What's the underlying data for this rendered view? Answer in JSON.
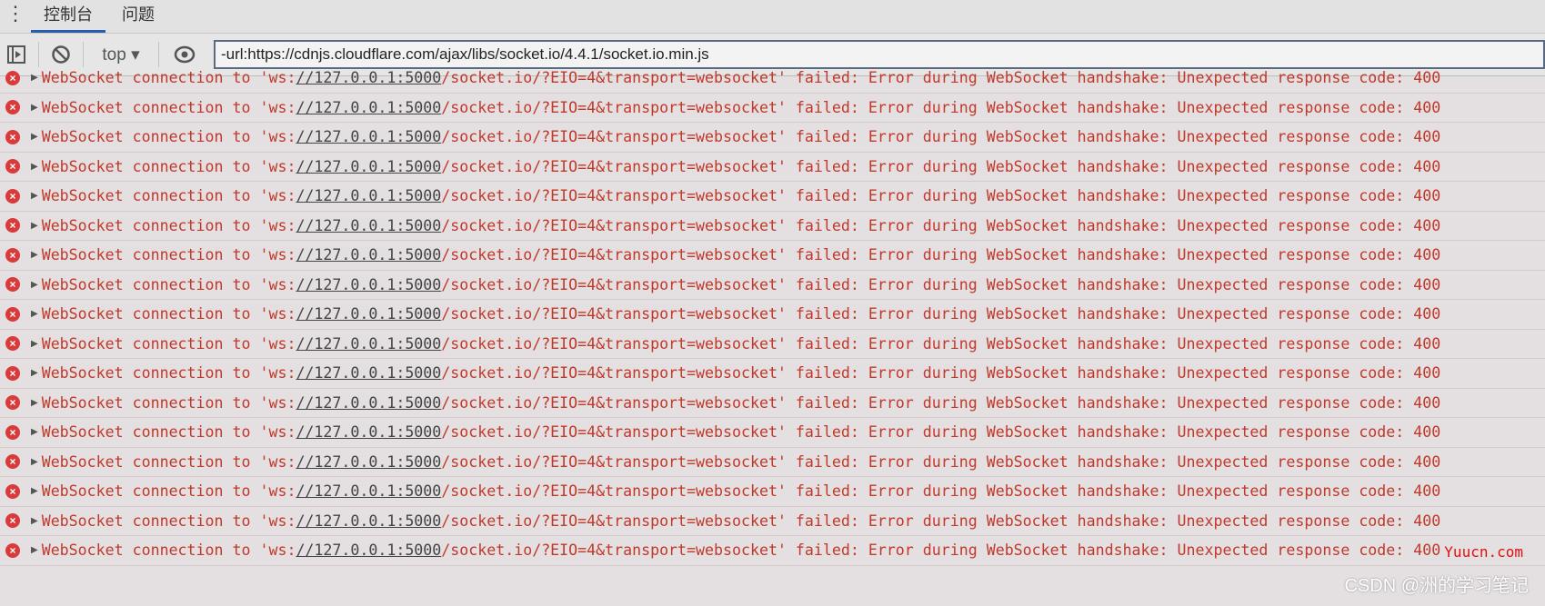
{
  "tabs": [
    {
      "label": "控制台",
      "active": true
    },
    {
      "label": "问题",
      "active": false
    }
  ],
  "toolbar": {
    "context": "top ▾",
    "filter_value": "-url:https://cdnjs.cloudflare.com/ajax/libs/socket.io/4.4.1/socket.io.min.js"
  },
  "log_entry": {
    "prefix": "WebSocket connection to 'ws:",
    "link": "//127.0.0.1:5000",
    "suffix": "/socket.io/?EIO=4&transport=websocket' failed: Error during WebSocket handshake: Unexpected response code: 400"
  },
  "log_count": 17,
  "colors": {
    "error": "#c0392b",
    "error_icon": "#d93a3a",
    "accent": "#2a5db0"
  },
  "watermarks": {
    "site": "Yuucn.com",
    "csdn": "CSDN @洲的学习笔记"
  }
}
